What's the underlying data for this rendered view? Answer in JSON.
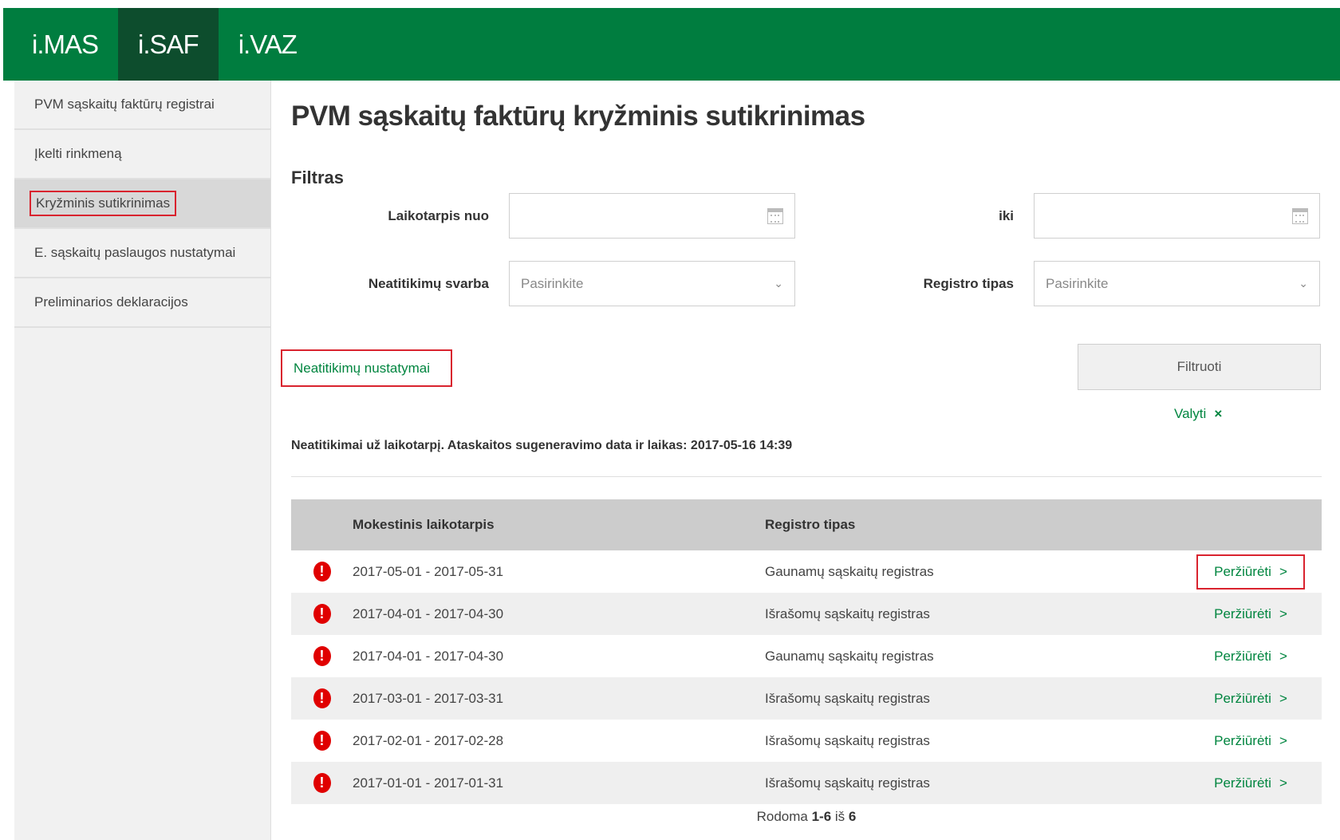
{
  "nav": {
    "tabs": [
      "i.MAS",
      "i.SAF",
      "i.VAZ"
    ],
    "active": "i.SAF"
  },
  "sidebar": {
    "items": [
      {
        "label": "PVM sąskaitų faktūrų registrai"
      },
      {
        "label": "Įkelti rinkmeną"
      },
      {
        "label": "Kryžminis sutikrinimas"
      },
      {
        "label": "E. sąskaitų paslaugos nustatymai"
      },
      {
        "label": "Preliminarios deklaracijos"
      }
    ]
  },
  "page": {
    "title": "PVM sąskaitų faktūrų kryžminis sutikrinimas",
    "filter_heading": "Filtras"
  },
  "filter": {
    "from_label": "Laikotarpis nuo",
    "to_label": "iki",
    "severity_label": "Neatitikimų svarba",
    "severity_placeholder": "Pasirinkite",
    "register_label": "Registro tipas",
    "register_placeholder": "Pasirinkite",
    "settings_link": "Neatitikimų nustatymai",
    "filter_button": "Filtruoti",
    "clear_link": "Valyti",
    "clear_icon": "×"
  },
  "report": {
    "text": "Neatitikimai už laikotarpį. Ataskaitos sugeneravimo data ir laikas: 2017-05-16 14:39"
  },
  "table": {
    "headers": [
      "Mokestinis laikotarpis",
      "Registro tipas"
    ],
    "view_label": "Peržiūrėti",
    "view_arrow": ">",
    "alert_glyph": "!",
    "rows": [
      {
        "period": "2017-05-01 - 2017-05-31",
        "type": "Gaunamų sąskaitų registras"
      },
      {
        "period": "2017-04-01 - 2017-04-30",
        "type": "Išrašomų sąskaitų registras"
      },
      {
        "period": "2017-04-01 - 2017-04-30",
        "type": "Gaunamų sąskaitų registras"
      },
      {
        "period": "2017-03-01 - 2017-03-31",
        "type": "Išrašomų sąskaitų registras"
      },
      {
        "period": "2017-02-01 - 2017-02-28",
        "type": "Išrašomų sąskaitų registras"
      },
      {
        "period": "2017-01-01 - 2017-01-31",
        "type": "Išrašomų sąskaitų registras"
      }
    ]
  },
  "pager": {
    "prefix": "Rodoma",
    "range": "1-6",
    "of": "iš",
    "total": "6"
  },
  "colors": {
    "brand_green": "#007d3f",
    "active_tab": "#0d4d2d",
    "link_green": "#00853f",
    "highlight_red": "#d9232e",
    "alert_red": "#e00000"
  }
}
